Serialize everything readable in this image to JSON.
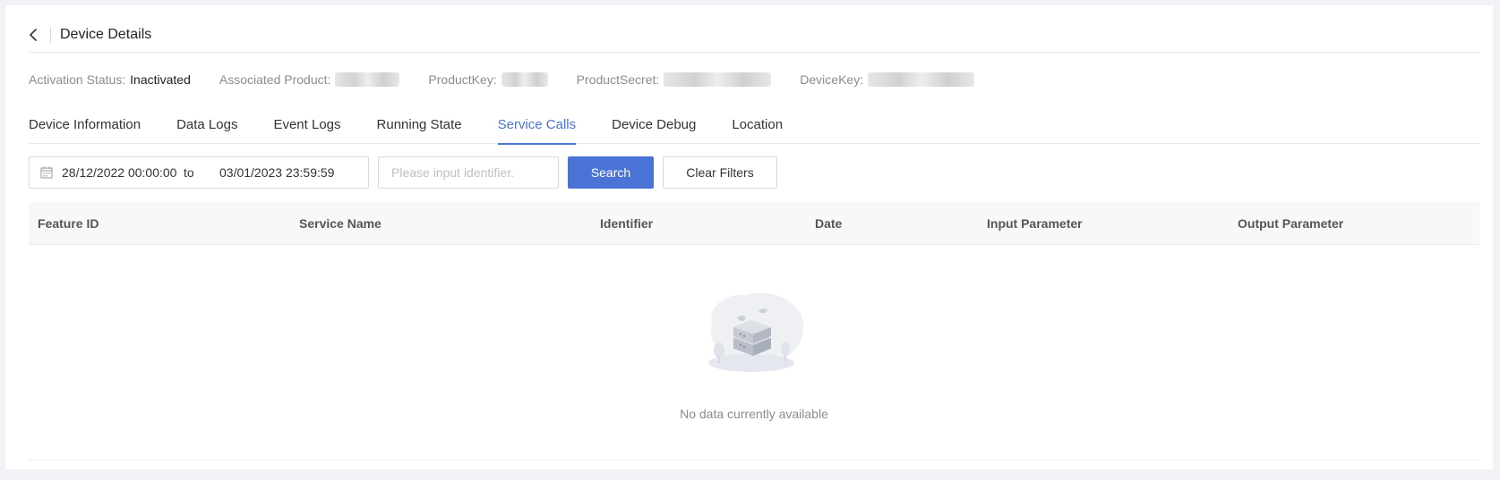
{
  "header": {
    "title": "Device Details"
  },
  "info": {
    "activation_label": "Activation Status:",
    "activation_value": "Inactivated",
    "product_label": "Associated Product:",
    "productkey_label": "ProductKey:",
    "productsecret_label": "ProductSecret:",
    "devicekey_label": "DeviceKey:"
  },
  "tabs": [
    {
      "label": "Device Information",
      "active": false
    },
    {
      "label": "Data Logs",
      "active": false
    },
    {
      "label": "Event Logs",
      "active": false
    },
    {
      "label": "Running State",
      "active": false
    },
    {
      "label": "Service Calls",
      "active": true
    },
    {
      "label": "Device Debug",
      "active": false
    },
    {
      "label": "Location",
      "active": false
    }
  ],
  "filters": {
    "date_start": "28/12/2022 00:00:00",
    "date_to": "to",
    "date_end": "03/01/2023 23:59:59",
    "identifier_placeholder": "Please input identifier.",
    "identifier_value": "",
    "search_label": "Search",
    "clear_label": "Clear Filters"
  },
  "table": {
    "columns": [
      "Feature ID",
      "Service Name",
      "Identifier",
      "Date",
      "Input Parameter",
      "Output Parameter"
    ],
    "rows": [],
    "empty_text": "No data currently available"
  },
  "colors": {
    "accent": "#4a73d6",
    "background": "#f0f2f5"
  },
  "icons": {
    "back": "chevron-left-icon",
    "calendar": "calendar-icon",
    "empty": "empty-data-illustration"
  }
}
